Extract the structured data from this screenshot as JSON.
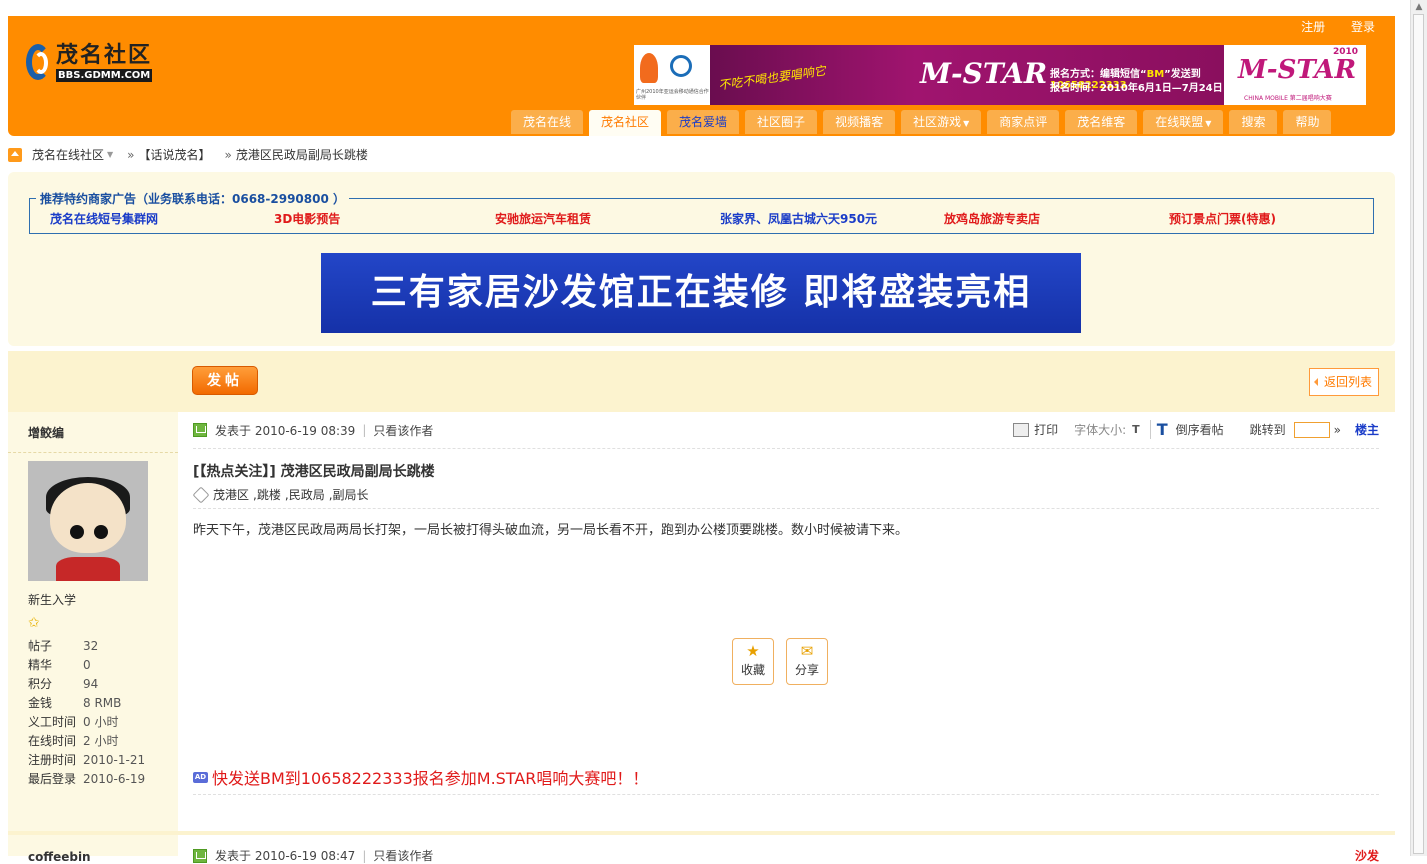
{
  "header": {
    "logo_title": "茂名社区",
    "logo_url": "BBS.GDMM.COM",
    "toplinks": [
      "注册",
      "登录"
    ],
    "banner": {
      "left_caption": "广州2010年亚运会移动通信合作伙伴",
      "slogan": "不吃不喝也要唱响它",
      "mstar": "M-STAR",
      "mstar_sub": "CHINA MOBILE",
      "info_label": "报名方式：编辑短信“",
      "info_code": "BM",
      "info_mid": "”发送到",
      "info_number": "10658222333",
      "info_time": "报名时间：2010年6月1日—7月24日",
      "right_year": "2010",
      "right_logo": "M-STAR",
      "right_sub": "CHINA MOBILE 第二届唱响大赛"
    },
    "nav": [
      {
        "label": "茂名在线",
        "state": "normal"
      },
      {
        "label": "茂名社区",
        "state": "active"
      },
      {
        "label": "茂名爱墙",
        "state": "blue"
      },
      {
        "label": "社区圈子",
        "state": "normal"
      },
      {
        "label": "视频播客",
        "state": "normal"
      },
      {
        "label": "社区游戏",
        "state": "dropdown"
      },
      {
        "label": "商家点评",
        "state": "normal"
      },
      {
        "label": "茂名维客",
        "state": "normal"
      },
      {
        "label": "在线联盟",
        "state": "dropdown"
      },
      {
        "label": "搜索",
        "state": "normal"
      },
      {
        "label": "帮助",
        "state": "normal"
      }
    ]
  },
  "breadcrumb": {
    "site": "茂名在线社区",
    "sep": "»",
    "forum": "【话说茂名】",
    "thread": "茂港区民政局副局长跳楼"
  },
  "ads": {
    "box_title": "推荐特约商家广告（业务联系电话：0668-2990800 ）",
    "links": [
      {
        "text": "茂名在线短号集群网",
        "color": "#1a3cc8"
      },
      {
        "text": "3D电影预告",
        "color": "#e01a1a"
      },
      {
        "text": "安驰旅运汽车租赁",
        "color": "#e01a1a"
      },
      {
        "text": "张家界、凤凰古城六天950元",
        "color": "#1a3cc8"
      },
      {
        "text": "放鸡岛旅游专卖店",
        "color": "#e01a1a"
      },
      {
        "text": "预订景点门票(特惠)",
        "color": "#e01a1a"
      }
    ],
    "big_banner": "三有家居沙发馆正在装修  即将盛装亮相"
  },
  "toolbar": {
    "post_button": "发帖",
    "back_button": "返回列表"
  },
  "post": {
    "author": "增鲛编",
    "usergroup": "新生入学",
    "stats": [
      {
        "k": "帖子",
        "v": "32"
      },
      {
        "k": "精华",
        "v": "0"
      },
      {
        "k": "积分",
        "v": "94"
      },
      {
        "k": "金钱",
        "v": "8 RMB"
      },
      {
        "k": "义工时间",
        "v": "0 小时"
      },
      {
        "k": "在线时间",
        "v": "2 小时"
      },
      {
        "k": "注册时间",
        "v": "2010-1-21"
      },
      {
        "k": "最后登录",
        "v": "2010-6-19"
      }
    ],
    "posted_at": "发表于  2010-6-19 08:39",
    "only_author": "只看该作者",
    "print": "打印",
    "font_size_label": "字体大小:",
    "font_small": "T",
    "font_large": "T",
    "reverse": "倒序看帖",
    "jump_to": "跳转到",
    "jump_arrow": "»",
    "floor": "楼主",
    "title_prefix": "[【热点关注】]",
    "title": "茂港区民政局副局长跳楼",
    "tags": [
      "茂港区",
      "跳楼",
      "民政局",
      "副局长"
    ],
    "body": "昨天下午，茂港区民政局两局长打架，一局长被打得头破血流，另一局长看不开，跑到办公楼顶要跳楼。数小时候被请下来。",
    "favorite": "收藏",
    "share": "分享",
    "ad_badge": "AD",
    "promo": "快发送BM到10658222333报名参加M.STAR唱响大赛吧！！"
  },
  "next_post": {
    "author": "coffeebin",
    "posted_at": "发表于  2010-6-19 08:47",
    "only_author": "只看该作者",
    "floor": "沙发"
  }
}
